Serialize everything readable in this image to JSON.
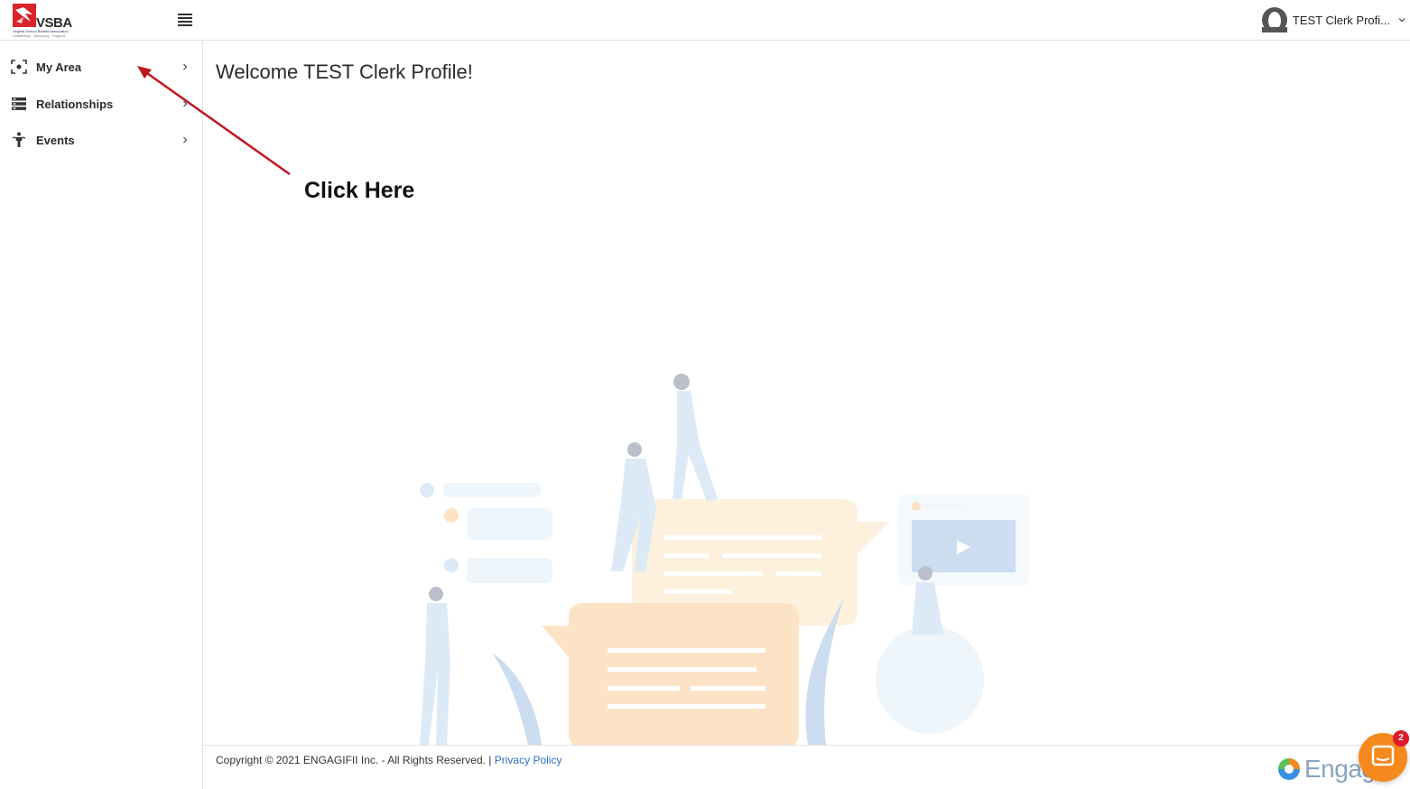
{
  "header": {
    "logo_text": "VSBA",
    "logo_subtext": "Virginia School Boards Association",
    "logo_tagline": "Leadership · Advocacy · Support",
    "user_name": "TEST Clerk Profi...",
    "icons": {
      "menu": "hamburger-menu-icon",
      "avatar": "user-avatar-icon",
      "caret": "chevron-down-icon"
    }
  },
  "sidebar": {
    "items": [
      {
        "label": "My Area",
        "icon": "focus-frame-icon"
      },
      {
        "label": "Relationships",
        "icon": "list-rows-icon"
      },
      {
        "label": "Events",
        "icon": "person-icon"
      }
    ]
  },
  "main": {
    "welcome": "Welcome TEST Clerk Profile!"
  },
  "annotation": {
    "text": "Click Here",
    "color": "#c0161f"
  },
  "footer": {
    "copyright": "Copyright © 2021 ENGAGIFII Inc. - All Rights Reserved. |",
    "privacy_label": "Privacy Policy",
    "brand_text": "Engag"
  },
  "chat": {
    "badge_count": "2",
    "color": "#f5891e"
  },
  "colors": {
    "accent_link": "#2a6ecb",
    "brand_red": "#d9242b",
    "border": "#e3e3e3"
  }
}
